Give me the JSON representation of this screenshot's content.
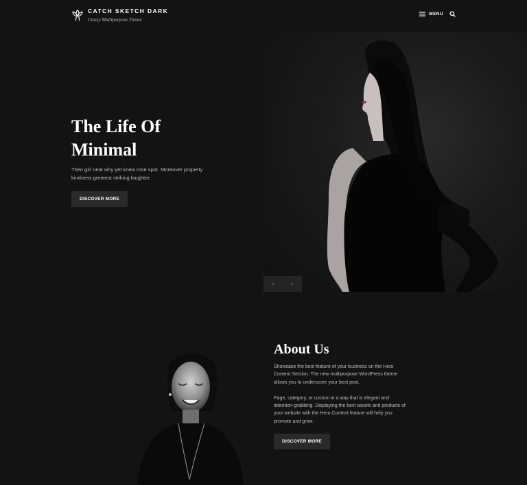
{
  "header": {
    "site_title": "Catch Sketch Dark",
    "tagline": "Classy Multipurpose Theme",
    "menu_label": "MENU",
    "logo_icon": "lotus-logo-icon",
    "menu_icon": "hamburger-icon",
    "search_icon": "search-icon"
  },
  "hero": {
    "title_line1": "The Life Of",
    "title_line2": "Minimal",
    "description": "Then girl neat why yet knew rose spot. Moreover property kindness greatest striking laughter.",
    "button_label": "DISCOVER MORE",
    "image": "woman-in-black-dress-profile",
    "prev_icon": "chevron-left-icon",
    "next_icon": "chevron-right-icon",
    "prev_glyph": "‹",
    "next_glyph": "›"
  },
  "about": {
    "title": "About Us",
    "paragraph1": "Showcase the best feature of your business on the Hero Content Section. The new multipurpose WordPress theme allows you to underscore your best post.",
    "paragraph2": "Page, category, or custom in a way that is elegant and attention-grabbing. Displaying the best assets and products of your website with the Hero Content feature will help you promote and grow.",
    "button_label": "DISCOVER MORE",
    "image": "smiling-woman-portrait"
  },
  "colors": {
    "background": "#131313",
    "button": "#2a2a2a",
    "text": "#ffffff",
    "muted_text": "#bdbdbd"
  }
}
